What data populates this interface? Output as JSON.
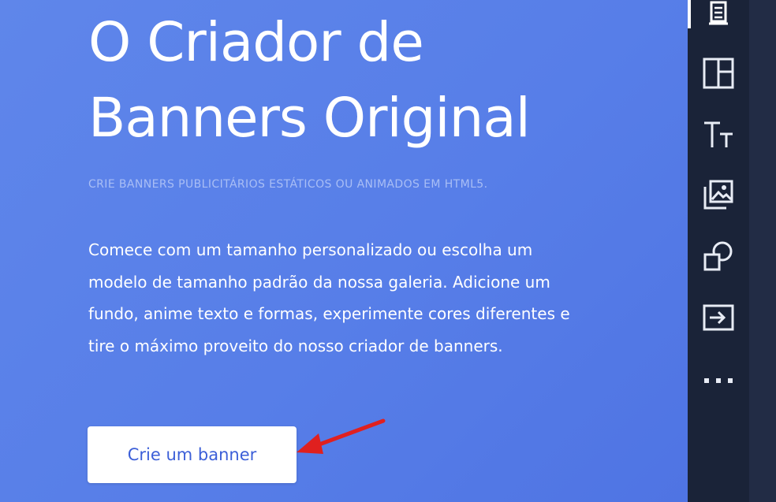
{
  "hero": {
    "title_line1": "O Criador de",
    "title_line2": "Banners Original",
    "subtitle": "CRIE BANNERS PUBLICITÁRIOS ESTÁTICOS OU ANIMADOS EM HTML5.",
    "description": "Comece com um tamanho personalizado ou escolha um modelo de tamanho padrão da nossa galeria. Adicione um fundo, anime texto e formas, experimente cores diferentes e tire o máximo proveito do nosso criador de banners.",
    "cta_label": "Crie um banner"
  },
  "toolbar": {
    "tools": [
      {
        "icon": "template-stack-icon",
        "active": true
      },
      {
        "icon": "layout-icon",
        "active": false
      },
      {
        "icon": "text-icon",
        "active": false
      },
      {
        "icon": "image-icon",
        "active": false
      },
      {
        "icon": "shapes-icon",
        "active": false
      },
      {
        "icon": "export-icon",
        "active": false
      },
      {
        "icon": "more-icon",
        "active": false
      }
    ]
  },
  "colors": {
    "hero_background": "#577ee8",
    "cta_text": "#3c5fd8",
    "toolbar_background": "#1a2338",
    "annotation_arrow": "#e0201f",
    "edge_strips": [
      "#3b5bd6",
      "#d9304a",
      "#f08b2c",
      "#2fb37b",
      "#6a4fd0",
      "#3b5bd6"
    ]
  }
}
